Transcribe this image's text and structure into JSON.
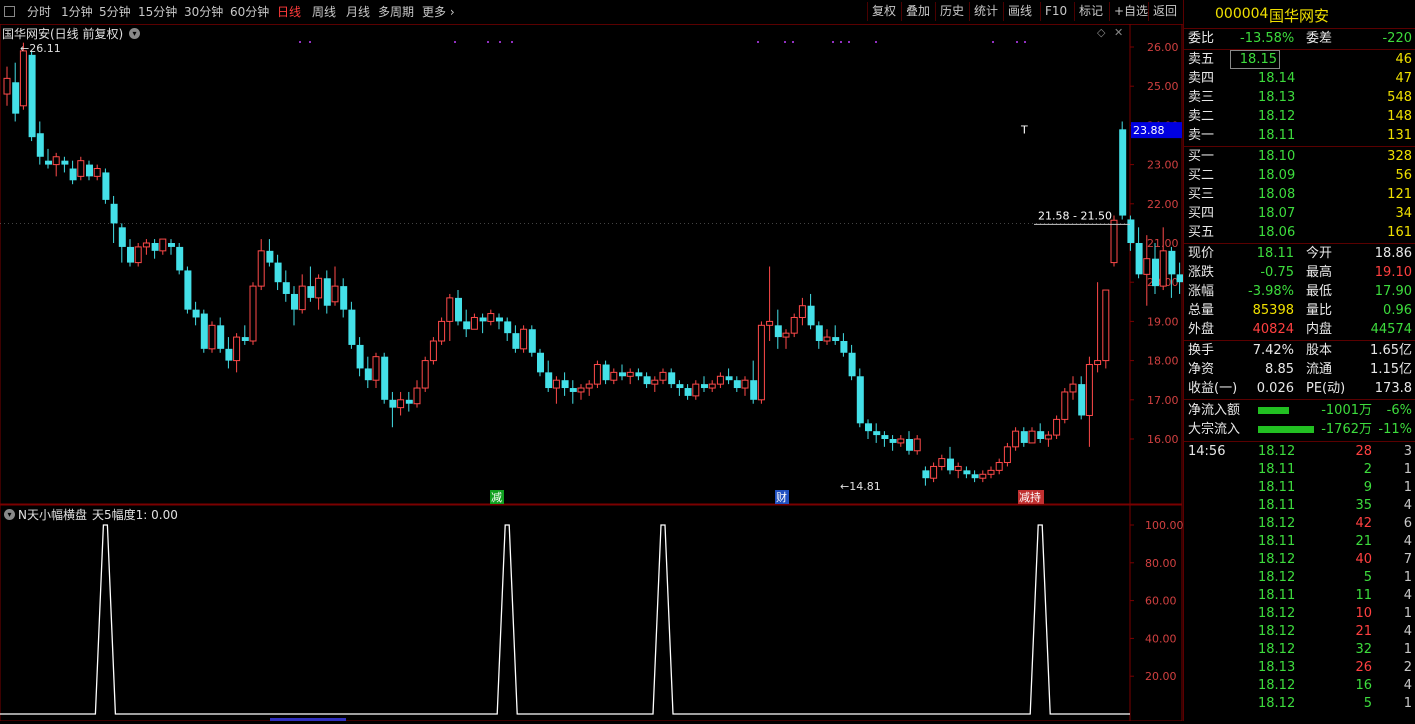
{
  "toolbar": {
    "periods": [
      {
        "label": "分时",
        "active": false
      },
      {
        "label": "1分钟",
        "active": false
      },
      {
        "label": "5分钟",
        "active": false
      },
      {
        "label": "15分钟",
        "active": false
      },
      {
        "label": "30分钟",
        "active": false
      },
      {
        "label": "60分钟",
        "active": false
      },
      {
        "label": "日线",
        "active": true
      },
      {
        "label": "周线",
        "active": false
      },
      {
        "label": "月线",
        "active": false
      },
      {
        "label": "多周期",
        "active": false
      },
      {
        "label": "更多",
        "active": false
      }
    ],
    "tools": [
      "复权",
      "叠加",
      "历史",
      "统计",
      "画线",
      "F10",
      "标记",
      "+自选",
      "返回"
    ]
  },
  "main_chart": {
    "title": "国华网安(日线 前复权)",
    "high_label": "26.11",
    "low_label": "14.81",
    "price_box": "23.88",
    "range_label": "21.58 - 21.50",
    "t_marker": "T",
    "tags": [
      "减",
      "财",
      "减持"
    ],
    "y_ticks": [
      "26.00",
      "25.00",
      "24.00",
      "23.00",
      "22.00",
      "21.00",
      "20.00",
      "19.00",
      "18.00",
      "17.00",
      "16.00"
    ]
  },
  "indicator": {
    "title": "N天小幅横盘",
    "param": "天5幅度1: 0.00",
    "y_ticks": [
      "100.00",
      "80.00",
      "60.00",
      "40.00",
      "20.00"
    ],
    "peaks": [
      12,
      61,
      80,
      126
    ]
  },
  "chart_data": {
    "type": "candlestick",
    "ylim": [
      14.5,
      26.5
    ],
    "candles": [
      [
        24.8,
        25.5,
        24.5,
        25.2
      ],
      [
        25.1,
        25.6,
        24.1,
        24.3
      ],
      [
        24.5,
        26.11,
        24.4,
        25.9
      ],
      [
        25.8,
        25.9,
        23.6,
        23.7
      ],
      [
        23.8,
        24.1,
        23.0,
        23.2
      ],
      [
        23.1,
        23.4,
        22.9,
        23.0
      ],
      [
        23.0,
        23.3,
        22.7,
        23.2
      ],
      [
        23.1,
        23.2,
        22.8,
        23.0
      ],
      [
        22.9,
        23.1,
        22.5,
        22.6
      ],
      [
        22.7,
        23.2,
        22.6,
        23.1
      ],
      [
        23.0,
        23.1,
        22.6,
        22.7
      ],
      [
        22.7,
        23.0,
        22.6,
        22.9
      ],
      [
        22.8,
        22.9,
        22.0,
        22.1
      ],
      [
        22.0,
        22.2,
        21.0,
        21.5
      ],
      [
        21.4,
        21.5,
        20.5,
        20.9
      ],
      [
        20.9,
        21.1,
        20.4,
        20.5
      ],
      [
        20.5,
        21.0,
        20.4,
        20.9
      ],
      [
        20.9,
        21.1,
        20.7,
        21.0
      ],
      [
        21.0,
        21.1,
        20.6,
        20.8
      ],
      [
        20.8,
        21.1,
        20.7,
        21.1
      ],
      [
        21.0,
        21.1,
        20.7,
        20.9
      ],
      [
        20.9,
        21.0,
        20.2,
        20.3
      ],
      [
        20.3,
        20.4,
        19.2,
        19.3
      ],
      [
        19.3,
        19.5,
        18.9,
        19.1
      ],
      [
        19.2,
        19.3,
        18.2,
        18.3
      ],
      [
        18.3,
        19.0,
        18.2,
        18.9
      ],
      [
        18.9,
        19.1,
        18.2,
        18.3
      ],
      [
        18.3,
        18.6,
        17.8,
        18.0
      ],
      [
        18.0,
        18.7,
        17.7,
        18.6
      ],
      [
        18.6,
        18.9,
        18.4,
        18.5
      ],
      [
        18.5,
        20.0,
        18.4,
        19.9
      ],
      [
        19.9,
        21.1,
        19.8,
        20.8
      ],
      [
        20.8,
        21.1,
        20.4,
        20.5
      ],
      [
        20.5,
        20.7,
        19.8,
        20.0
      ],
      [
        20.0,
        20.3,
        19.5,
        19.7
      ],
      [
        19.7,
        19.9,
        18.9,
        19.3
      ],
      [
        19.3,
        20.2,
        19.2,
        19.9
      ],
      [
        19.9,
        20.4,
        19.5,
        19.6
      ],
      [
        19.6,
        20.2,
        19.3,
        20.1
      ],
      [
        20.1,
        20.3,
        19.2,
        19.4
      ],
      [
        19.5,
        20.4,
        19.4,
        19.9
      ],
      [
        19.9,
        20.1,
        19.1,
        19.3
      ],
      [
        19.3,
        19.5,
        18.3,
        18.4
      ],
      [
        18.4,
        18.6,
        17.6,
        17.8
      ],
      [
        17.8,
        18.1,
        17.3,
        17.5
      ],
      [
        17.5,
        18.2,
        17.3,
        18.1
      ],
      [
        18.1,
        18.2,
        16.9,
        17.0
      ],
      [
        17.0,
        17.2,
        16.3,
        16.8
      ],
      [
        16.8,
        17.2,
        16.6,
        17.0
      ],
      [
        17.0,
        17.2,
        16.7,
        16.9
      ],
      [
        16.9,
        17.5,
        16.8,
        17.3
      ],
      [
        17.3,
        18.1,
        17.2,
        18.0
      ],
      [
        18.0,
        18.6,
        17.9,
        18.5
      ],
      [
        18.5,
        19.1,
        18.4,
        19.0
      ],
      [
        19.0,
        19.7,
        18.5,
        19.6
      ],
      [
        19.6,
        19.8,
        18.9,
        19.0
      ],
      [
        19.0,
        19.3,
        18.6,
        18.8
      ],
      [
        18.8,
        19.2,
        18.8,
        19.1
      ],
      [
        19.1,
        19.2,
        18.7,
        19.0
      ],
      [
        19.0,
        19.3,
        18.9,
        19.2
      ],
      [
        19.1,
        19.2,
        18.8,
        19.0
      ],
      [
        19.0,
        19.1,
        18.5,
        18.7
      ],
      [
        18.7,
        18.9,
        18.2,
        18.3
      ],
      [
        18.3,
        18.9,
        18.2,
        18.8
      ],
      [
        18.8,
        18.9,
        18.1,
        18.2
      ],
      [
        18.2,
        18.3,
        17.6,
        17.7
      ],
      [
        17.7,
        18.0,
        17.2,
        17.3
      ],
      [
        17.3,
        17.6,
        16.9,
        17.5
      ],
      [
        17.5,
        17.7,
        17.1,
        17.3
      ],
      [
        17.3,
        17.5,
        16.9,
        17.2
      ],
      [
        17.2,
        17.4,
        17.0,
        17.3
      ],
      [
        17.3,
        17.5,
        17.1,
        17.4
      ],
      [
        17.4,
        18.0,
        17.3,
        17.9
      ],
      [
        17.9,
        18.0,
        17.4,
        17.5
      ],
      [
        17.5,
        17.8,
        17.4,
        17.7
      ],
      [
        17.7,
        17.9,
        17.5,
        17.6
      ],
      [
        17.6,
        17.8,
        17.4,
        17.7
      ],
      [
        17.7,
        17.8,
        17.5,
        17.6
      ],
      [
        17.6,
        17.7,
        17.3,
        17.4
      ],
      [
        17.4,
        17.6,
        17.2,
        17.5
      ],
      [
        17.5,
        17.8,
        17.4,
        17.7
      ],
      [
        17.7,
        17.8,
        17.3,
        17.4
      ],
      [
        17.4,
        17.5,
        17.1,
        17.3
      ],
      [
        17.3,
        17.4,
        17.0,
        17.1
      ],
      [
        17.1,
        17.5,
        17.0,
        17.4
      ],
      [
        17.4,
        17.6,
        17.2,
        17.3
      ],
      [
        17.3,
        17.5,
        17.2,
        17.4
      ],
      [
        17.4,
        17.7,
        17.3,
        17.6
      ],
      [
        17.6,
        17.8,
        17.4,
        17.5
      ],
      [
        17.5,
        17.6,
        17.2,
        17.3
      ],
      [
        17.3,
        17.6,
        17.1,
        17.5
      ],
      [
        17.5,
        18.0,
        16.9,
        17.0
      ],
      [
        17.0,
        19.0,
        16.9,
        18.9
      ],
      [
        18.9,
        20.4,
        18.5,
        19.0
      ],
      [
        18.9,
        19.3,
        18.3,
        18.6
      ],
      [
        18.6,
        18.8,
        18.3,
        18.7
      ],
      [
        18.7,
        19.2,
        18.6,
        19.1
      ],
      [
        19.1,
        19.6,
        18.9,
        19.4
      ],
      [
        19.4,
        19.7,
        18.8,
        18.9
      ],
      [
        18.9,
        19.0,
        18.3,
        18.5
      ],
      [
        18.5,
        18.8,
        18.4,
        18.6
      ],
      [
        18.6,
        18.9,
        18.4,
        18.5
      ],
      [
        18.5,
        18.7,
        18.1,
        18.2
      ],
      [
        18.2,
        18.4,
        17.5,
        17.6
      ],
      [
        17.6,
        17.8,
        16.3,
        16.4
      ],
      [
        16.4,
        16.5,
        16.0,
        16.2
      ],
      [
        16.2,
        16.4,
        15.9,
        16.1
      ],
      [
        16.1,
        16.2,
        15.8,
        16.0
      ],
      [
        16.0,
        16.1,
        15.7,
        15.9
      ],
      [
        15.9,
        16.1,
        15.8,
        16.0
      ],
      [
        16.0,
        16.2,
        15.6,
        15.7
      ],
      [
        15.7,
        16.1,
        15.6,
        16.0
      ],
      [
        15.2,
        15.3,
        14.81,
        15.0
      ],
      [
        15.0,
        15.4,
        14.9,
        15.3
      ],
      [
        15.3,
        15.6,
        15.2,
        15.5
      ],
      [
        15.5,
        15.8,
        15.1,
        15.2
      ],
      [
        15.2,
        15.4,
        15.0,
        15.3
      ],
      [
        15.2,
        15.3,
        15.0,
        15.1
      ],
      [
        15.1,
        15.2,
        14.9,
        15.0
      ],
      [
        15.0,
        15.2,
        14.9,
        15.1
      ],
      [
        15.1,
        15.3,
        15.0,
        15.2
      ],
      [
        15.2,
        15.5,
        15.1,
        15.4
      ],
      [
        15.4,
        15.9,
        15.3,
        15.8
      ],
      [
        15.8,
        16.3,
        15.7,
        16.2
      ],
      [
        16.2,
        16.3,
        15.8,
        15.9
      ],
      [
        15.9,
        16.3,
        15.9,
        16.2
      ],
      [
        16.2,
        16.4,
        15.9,
        16.0
      ],
      [
        16.0,
        16.2,
        15.8,
        16.1
      ],
      [
        16.1,
        16.6,
        16.0,
        16.5
      ],
      [
        16.5,
        17.3,
        16.4,
        17.2
      ],
      [
        17.2,
        17.6,
        17.0,
        17.4
      ],
      [
        17.4,
        17.6,
        16.5,
        16.6
      ],
      [
        16.6,
        18.1,
        15.8,
        17.9
      ],
      [
        17.9,
        20.0,
        17.7,
        18.0
      ],
      [
        18.0,
        19.8,
        17.8,
        19.8
      ],
      [
        20.5,
        21.7,
        20.4,
        21.58
      ],
      [
        23.9,
        24.1,
        21.6,
        21.7
      ],
      [
        21.6,
        21.7,
        20.8,
        21.0
      ],
      [
        21.0,
        21.4,
        20.1,
        20.2
      ],
      [
        20.2,
        21.2,
        19.4,
        20.6
      ],
      [
        20.6,
        21.0,
        19.7,
        19.9
      ],
      [
        19.9,
        21.4,
        19.8,
        20.8
      ],
      [
        20.8,
        20.9,
        19.6,
        20.2
      ],
      [
        20.2,
        20.5,
        19.7,
        20.0
      ],
      [
        20.1,
        20.3,
        18.9,
        19.0
      ],
      [
        18.9,
        19.1,
        17.9,
        18.11
      ]
    ]
  },
  "quote": {
    "code": "000004",
    "name": "国华网安",
    "weibi_label": "委比",
    "weibi": "-13.58%",
    "weicha_label": "委差",
    "weicha": "-220",
    "sells": [
      {
        "label": "卖五",
        "price": "18.15",
        "vol": "46"
      },
      {
        "label": "卖四",
        "price": "18.14",
        "vol": "47"
      },
      {
        "label": "卖三",
        "price": "18.13",
        "vol": "548"
      },
      {
        "label": "卖二",
        "price": "18.12",
        "vol": "148"
      },
      {
        "label": "卖一",
        "price": "18.11",
        "vol": "131"
      }
    ],
    "buys": [
      {
        "label": "买一",
        "price": "18.10",
        "vol": "328"
      },
      {
        "label": "买二",
        "price": "18.09",
        "vol": "56"
      },
      {
        "label": "买三",
        "price": "18.08",
        "vol": "121"
      },
      {
        "label": "买四",
        "price": "18.07",
        "vol": "34"
      },
      {
        "label": "买五",
        "price": "18.06",
        "vol": "161"
      }
    ],
    "stats": [
      {
        "l1": "现价",
        "v1": "18.11",
        "c1": "green",
        "l2": "今开",
        "v2": "18.86",
        "c2": "white"
      },
      {
        "l1": "涨跌",
        "v1": "-0.75",
        "c1": "green",
        "l2": "最高",
        "v2": "19.10",
        "c2": "red"
      },
      {
        "l1": "涨幅",
        "v1": "-3.98%",
        "c1": "green",
        "l2": "最低",
        "v2": "17.90",
        "c2": "green"
      },
      {
        "l1": "总量",
        "v1": "85398",
        "c1": "yellow",
        "l2": "量比",
        "v2": "0.96",
        "c2": "green"
      },
      {
        "l1": "外盘",
        "v1": "40824",
        "c1": "red",
        "l2": "内盘",
        "v2": "44574",
        "c2": "green"
      }
    ],
    "stats2": [
      {
        "l1": "换手",
        "v1": "7.42%",
        "c1": "white",
        "l2": "股本",
        "v2": "1.65亿",
        "c2": "white"
      },
      {
        "l1": "净资",
        "v1": "8.85",
        "c1": "white",
        "l2": "流通",
        "v2": "1.15亿",
        "c2": "white"
      },
      {
        "l1": "收益(一)",
        "v1": "0.026",
        "c1": "white",
        "l2": "PE(动)",
        "v2": "173.8",
        "c2": "white"
      }
    ],
    "flows": [
      {
        "label": "净流入额",
        "value": "-1001万",
        "pct": "-6%",
        "bar": 0.35
      },
      {
        "label": "大宗流入",
        "value": "-1762万",
        "pct": "-11%",
        "bar": 0.62
      }
    ],
    "ticks": [
      {
        "time": "14:56",
        "price": "18.12",
        "vol": "28",
        "vc": "red",
        "n": "3"
      },
      {
        "time": "",
        "price": "18.11",
        "vol": "2",
        "vc": "green",
        "n": "1"
      },
      {
        "time": "",
        "price": "18.11",
        "vol": "9",
        "vc": "green",
        "n": "1"
      },
      {
        "time": "",
        "price": "18.11",
        "vol": "35",
        "vc": "green",
        "n": "4"
      },
      {
        "time": "",
        "price": "18.12",
        "vol": "42",
        "vc": "red",
        "n": "6"
      },
      {
        "time": "",
        "price": "18.11",
        "vol": "21",
        "vc": "green",
        "n": "4"
      },
      {
        "time": "",
        "price": "18.12",
        "vol": "40",
        "vc": "red",
        "n": "7"
      },
      {
        "time": "",
        "price": "18.12",
        "vol": "5",
        "vc": "green",
        "n": "1"
      },
      {
        "time": "",
        "price": "18.11",
        "vol": "11",
        "vc": "green",
        "n": "4"
      },
      {
        "time": "",
        "price": "18.12",
        "vol": "10",
        "vc": "red",
        "n": "1"
      },
      {
        "time": "",
        "price": "18.12",
        "vol": "21",
        "vc": "red",
        "n": "4"
      },
      {
        "time": "",
        "price": "18.12",
        "vol": "32",
        "vc": "green",
        "n": "1"
      },
      {
        "time": "",
        "price": "18.13",
        "vol": "26",
        "vc": "red",
        "n": "2"
      },
      {
        "time": "",
        "price": "18.12",
        "vol": "16",
        "vc": "green",
        "n": "4"
      },
      {
        "time": "",
        "price": "18.12",
        "vol": "5",
        "vc": "green",
        "n": "1"
      }
    ],
    "tick_price_color": "#3ddc3d"
  }
}
